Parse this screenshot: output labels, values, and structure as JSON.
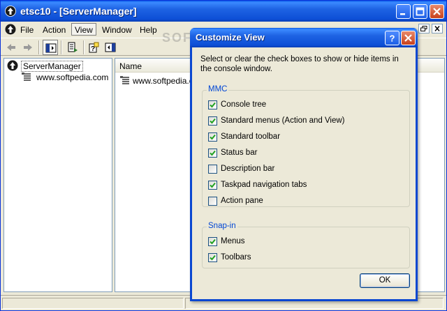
{
  "main_window": {
    "title": "etsc10 - [ServerManager]",
    "menu": [
      "File",
      "Action",
      "View",
      "Window",
      "Help"
    ],
    "active_menu_index": 2,
    "tree": {
      "root": "ServerManager",
      "children": [
        "www.softpedia.com"
      ]
    },
    "result": {
      "column_name": "Name",
      "items": [
        "www.softpedia.com"
      ]
    }
  },
  "watermark": "SOFTPEDIA",
  "dialog": {
    "title": "Customize View",
    "description": "Select or clear the check boxes to show or hide items in the console window.",
    "groups": [
      {
        "label": "MMC",
        "options": [
          {
            "label": "Console tree",
            "checked": true
          },
          {
            "label": "Standard menus (Action and View)",
            "checked": true
          },
          {
            "label": "Standard toolbar",
            "checked": true
          },
          {
            "label": "Status bar",
            "checked": true
          },
          {
            "label": "Description bar",
            "checked": false
          },
          {
            "label": "Taskpad navigation tabs",
            "checked": true
          },
          {
            "label": "Action pane",
            "checked": false
          }
        ]
      },
      {
        "label": "Snap-in",
        "options": [
          {
            "label": "Menus",
            "checked": true
          },
          {
            "label": "Toolbars",
            "checked": true
          }
        ]
      }
    ],
    "ok_label": "OK"
  },
  "colors": {
    "titlebar_blue": "#0d4fd6",
    "group_label_blue": "#0046d5",
    "window_bg": "#ece9d8",
    "check_green": "#21a121"
  },
  "icons": {
    "app": "mmc-arrow-icon",
    "help": "help-icon",
    "close": "close-icon",
    "minimize": "minimize-icon",
    "maximize": "maximize-icon"
  }
}
